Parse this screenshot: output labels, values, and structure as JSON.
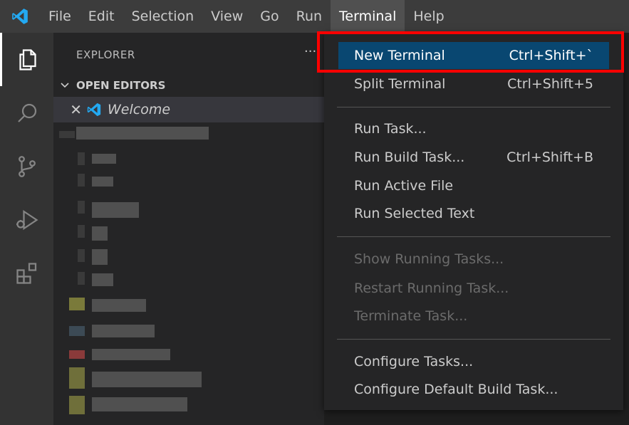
{
  "menubar": {
    "items": [
      "File",
      "Edit",
      "Selection",
      "View",
      "Go",
      "Run",
      "Terminal",
      "Help"
    ],
    "active": "Terminal"
  },
  "activity": [
    "explorer-icon",
    "search-icon",
    "source-control-icon",
    "run-debug-icon",
    "extensions-icon"
  ],
  "sidebar": {
    "title": "EXPLORER",
    "more": "···",
    "open_editors_label": "OPEN EDITORS",
    "open_editor": {
      "close_glyph": "✕",
      "name": "Welcome"
    }
  },
  "terminal_menu": {
    "groups": [
      [
        {
          "label": "New Terminal",
          "shortcut": "Ctrl+Shift+`",
          "selected": true
        },
        {
          "label": "Split Terminal",
          "shortcut": "Ctrl+Shift+5"
        }
      ],
      [
        {
          "label": "Run Task...",
          "shortcut": ""
        },
        {
          "label": "Run Build Task...",
          "shortcut": "Ctrl+Shift+B"
        },
        {
          "label": "Run Active File",
          "shortcut": ""
        },
        {
          "label": "Run Selected Text",
          "shortcut": ""
        }
      ],
      [
        {
          "label": "Show Running Tasks...",
          "shortcut": "",
          "disabled": true
        },
        {
          "label": "Restart Running Task...",
          "shortcut": "",
          "disabled": true
        },
        {
          "label": "Terminate Task...",
          "shortcut": "",
          "disabled": true
        }
      ],
      [
        {
          "label": "Configure Tasks...",
          "shortcut": ""
        },
        {
          "label": "Configure Default Build Task...",
          "shortcut": ""
        }
      ]
    ]
  },
  "colors": {
    "menubar_bg": "#3c3c3c",
    "selection_bg": "#094771",
    "highlight_border": "#ff0000",
    "vscode_blue": "#23a9f2"
  }
}
